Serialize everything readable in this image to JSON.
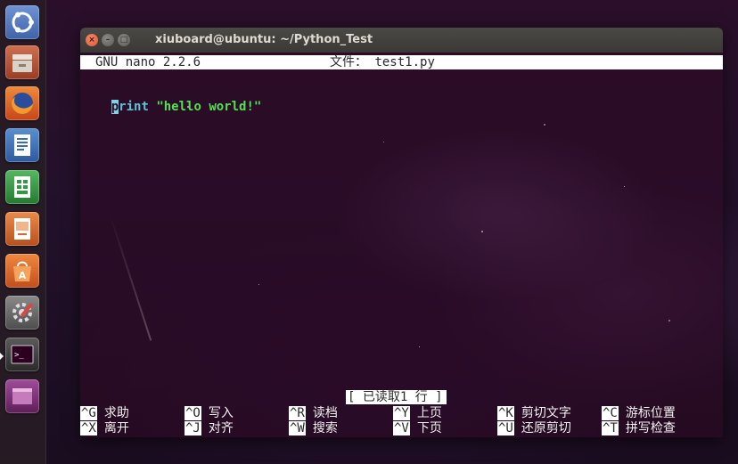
{
  "window": {
    "title": "xiuboard@ubuntu: ~/Python_Test",
    "controls": {
      "close": "×",
      "minimize": "–",
      "maximize": "□"
    }
  },
  "nano": {
    "version": "GNU nano 2.2.6",
    "file_label": "文件：",
    "file_name": "test1.py",
    "code": {
      "cursor_char": "p",
      "keyword_rest": "rint",
      "string": "\"hello world!\""
    },
    "status_message": "[ 已读取1 行 ]",
    "shortcuts_row1": [
      {
        "key": "^G",
        "label": "求助"
      },
      {
        "key": "^O",
        "label": "写入"
      },
      {
        "key": "^R",
        "label": "读档"
      },
      {
        "key": "^Y",
        "label": "上页"
      },
      {
        "key": "^K",
        "label": "剪切文字"
      },
      {
        "key": "^C",
        "label": "游标位置"
      }
    ],
    "shortcuts_row2": [
      {
        "key": "^X",
        "label": "离开"
      },
      {
        "key": "^J",
        "label": "对齐"
      },
      {
        "key": "^W",
        "label": "搜索"
      },
      {
        "key": "^V",
        "label": "下页"
      },
      {
        "key": "^U",
        "label": "还原剪切"
      },
      {
        "key": "^T",
        "label": "拼写检查"
      }
    ]
  },
  "launcher": {
    "items": [
      {
        "icon": "ubuntu-dash-icon",
        "color": "#5a7fc4"
      },
      {
        "icon": "files-icon",
        "color": "#b9573b"
      },
      {
        "icon": "firefox-icon",
        "color": "#e66a1f"
      },
      {
        "icon": "writer-icon",
        "color": "#3a6fb5"
      },
      {
        "icon": "calc-icon",
        "color": "#2f9a3f"
      },
      {
        "icon": "impress-icon",
        "color": "#d8672c"
      },
      {
        "icon": "software-center-icon",
        "color": "#e0662c"
      },
      {
        "icon": "system-settings-icon",
        "color": "#6b6b6b"
      },
      {
        "icon": "terminal-icon",
        "color": "#3a3a3a"
      },
      {
        "icon": "workspace-switcher-icon",
        "color": "#7a2f74"
      }
    ]
  }
}
